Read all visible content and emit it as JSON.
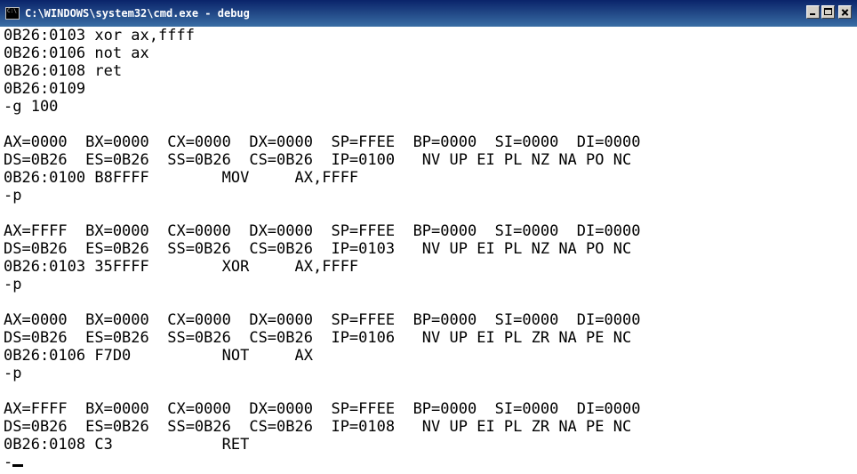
{
  "window": {
    "title": "C:\\WINDOWS\\system32\\cmd.exe - debug",
    "icon": "console-icon",
    "controls": [
      "minimize-icon",
      "maximize-icon",
      "close-icon"
    ],
    "titlebar_color": "#0a246a",
    "background": "#ffffff",
    "text_color": "#000000"
  },
  "console": {
    "lines": [
      "0B26:0103 xor ax,ffff",
      "0B26:0106 not ax",
      "0B26:0108 ret",
      "0B26:0109",
      "-g 100",
      "",
      "AX=0000  BX=0000  CX=0000  DX=0000  SP=FFEE  BP=0000  SI=0000  DI=0000",
      "DS=0B26  ES=0B26  SS=0B26  CS=0B26  IP=0100   NV UP EI PL NZ NA PO NC",
      "0B26:0100 B8FFFF        MOV     AX,FFFF",
      "-p",
      "",
      "AX=FFFF  BX=0000  CX=0000  DX=0000  SP=FFEE  BP=0000  SI=0000  DI=0000",
      "DS=0B26  ES=0B26  SS=0B26  CS=0B26  IP=0103   NV UP EI PL NZ NA PO NC",
      "0B26:0103 35FFFF        XOR     AX,FFFF",
      "-p",
      "",
      "AX=0000  BX=0000  CX=0000  DX=0000  SP=FFEE  BP=0000  SI=0000  DI=0000",
      "DS=0B26  ES=0B26  SS=0B26  CS=0B26  IP=0106   NV UP EI PL ZR NA PE NC",
      "0B26:0106 F7D0          NOT     AX",
      "-p",
      "",
      "AX=FFFF  BX=0000  CX=0000  DX=0000  SP=FFEE  BP=0000  SI=0000  DI=0000",
      "DS=0B26  ES=0B26  SS=0B26  CS=0B26  IP=0108   NV UP EI PL ZR NA PE NC",
      "0B26:0108 C3            RET"
    ],
    "prompt": "-"
  }
}
